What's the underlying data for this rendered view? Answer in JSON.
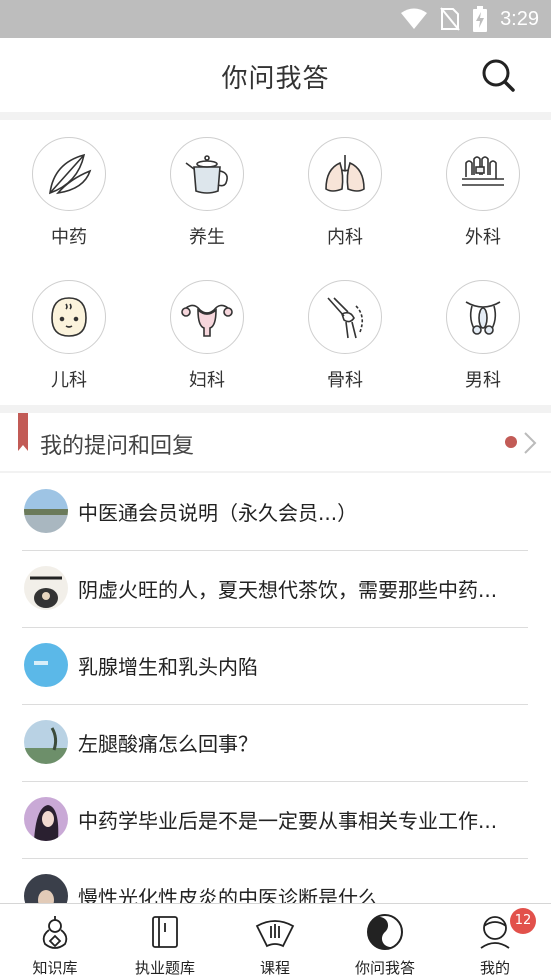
{
  "status_bar": {
    "time": "3:29"
  },
  "header": {
    "title": "你问我答"
  },
  "categories": [
    {
      "label": "中药"
    },
    {
      "label": "养生"
    },
    {
      "label": "内科"
    },
    {
      "label": "外科"
    },
    {
      "label": "儿科"
    },
    {
      "label": "妇科"
    },
    {
      "label": "骨科"
    },
    {
      "label": "男科"
    }
  ],
  "section": {
    "title": "我的提问和回复",
    "accent": "#c25b56"
  },
  "questions": [
    {
      "title": "中医通会员说明（永久会员...）"
    },
    {
      "title": "阴虚火旺的人，夏天想代茶饮，需要那些中药..."
    },
    {
      "title": "乳腺增生和乳头内陷"
    },
    {
      "title": "左腿酸痛怎么回事？"
    },
    {
      "title": "中药学毕业后是不是一定要从事相关专业工作..."
    },
    {
      "title": "慢性光化性皮炎的中医诊断是什么"
    }
  ],
  "tabs": [
    {
      "label": "知识库"
    },
    {
      "label": "执业题库"
    },
    {
      "label": "课程"
    },
    {
      "label": "你问我答"
    },
    {
      "label": "我的",
      "badge": "12"
    }
  ],
  "colors": {
    "badge": "#e2514b",
    "status_bar": "#bdbdbd"
  }
}
